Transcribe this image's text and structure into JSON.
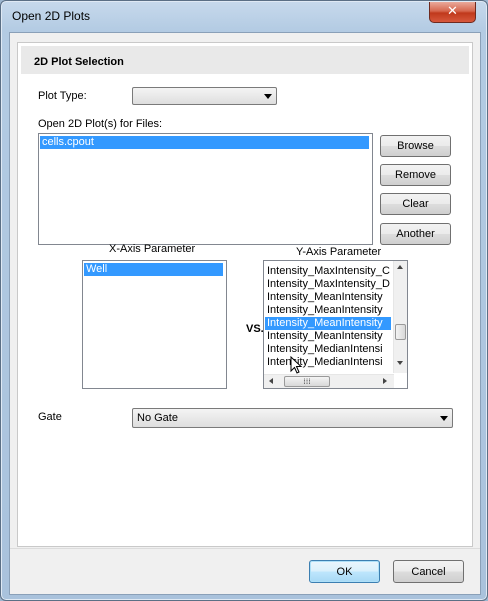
{
  "window": {
    "title": "Open 2D Plots",
    "close_glyph": "✕"
  },
  "group": {
    "title": "2D Plot Selection"
  },
  "plot_type": {
    "label": "Plot Type:",
    "value": ""
  },
  "files": {
    "label": "Open 2D Plot(s) for Files:",
    "items": [
      "cells.cpout"
    ],
    "selected_index": 0
  },
  "file_buttons": {
    "browse": "Browse",
    "remove": "Remove",
    "clear": "Clear",
    "another": "Another"
  },
  "x_axis": {
    "label": "X-Axis Parameter",
    "items": [
      "Well"
    ],
    "selected_index": 0
  },
  "vs_label": "VS.",
  "y_axis": {
    "label": "Y-Axis Parameter",
    "items": [
      "Intensity_MaxIntensity_C",
      "Intensity_MaxIntensity_D",
      "Intensity_MeanIntensity",
      "Intensity_MeanIntensity",
      "Intensity_MeanIntensity",
      "Intensity_MeanIntensity",
      "Intensity_MedianIntensi",
      "Intensity_MedianIntensi"
    ],
    "selected_index": 4
  },
  "gate": {
    "label": "Gate",
    "value": "No Gate"
  },
  "footer": {
    "ok": "OK",
    "cancel": "Cancel"
  },
  "colors": {
    "selection": "#3399ff",
    "default_button_border": "#3c7fb1",
    "close_button": "#c0391c"
  },
  "icons": {
    "close": "close-icon",
    "dropdown": "chevron-down-icon",
    "cursor": "mouse-pointer-icon"
  }
}
